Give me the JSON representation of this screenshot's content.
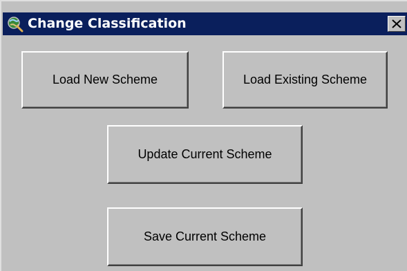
{
  "window": {
    "title": "Change Classification",
    "icon": "globe-magnifier-icon",
    "close_icon": "close-icon"
  },
  "buttons": {
    "load_new": "Load New Scheme",
    "load_existing": "Load Existing Scheme",
    "update_current": "Update Current Scheme",
    "save_current": "Save Current Scheme"
  },
  "colors": {
    "title_bar": "#0a1f5c",
    "face": "#c0c0c0"
  }
}
